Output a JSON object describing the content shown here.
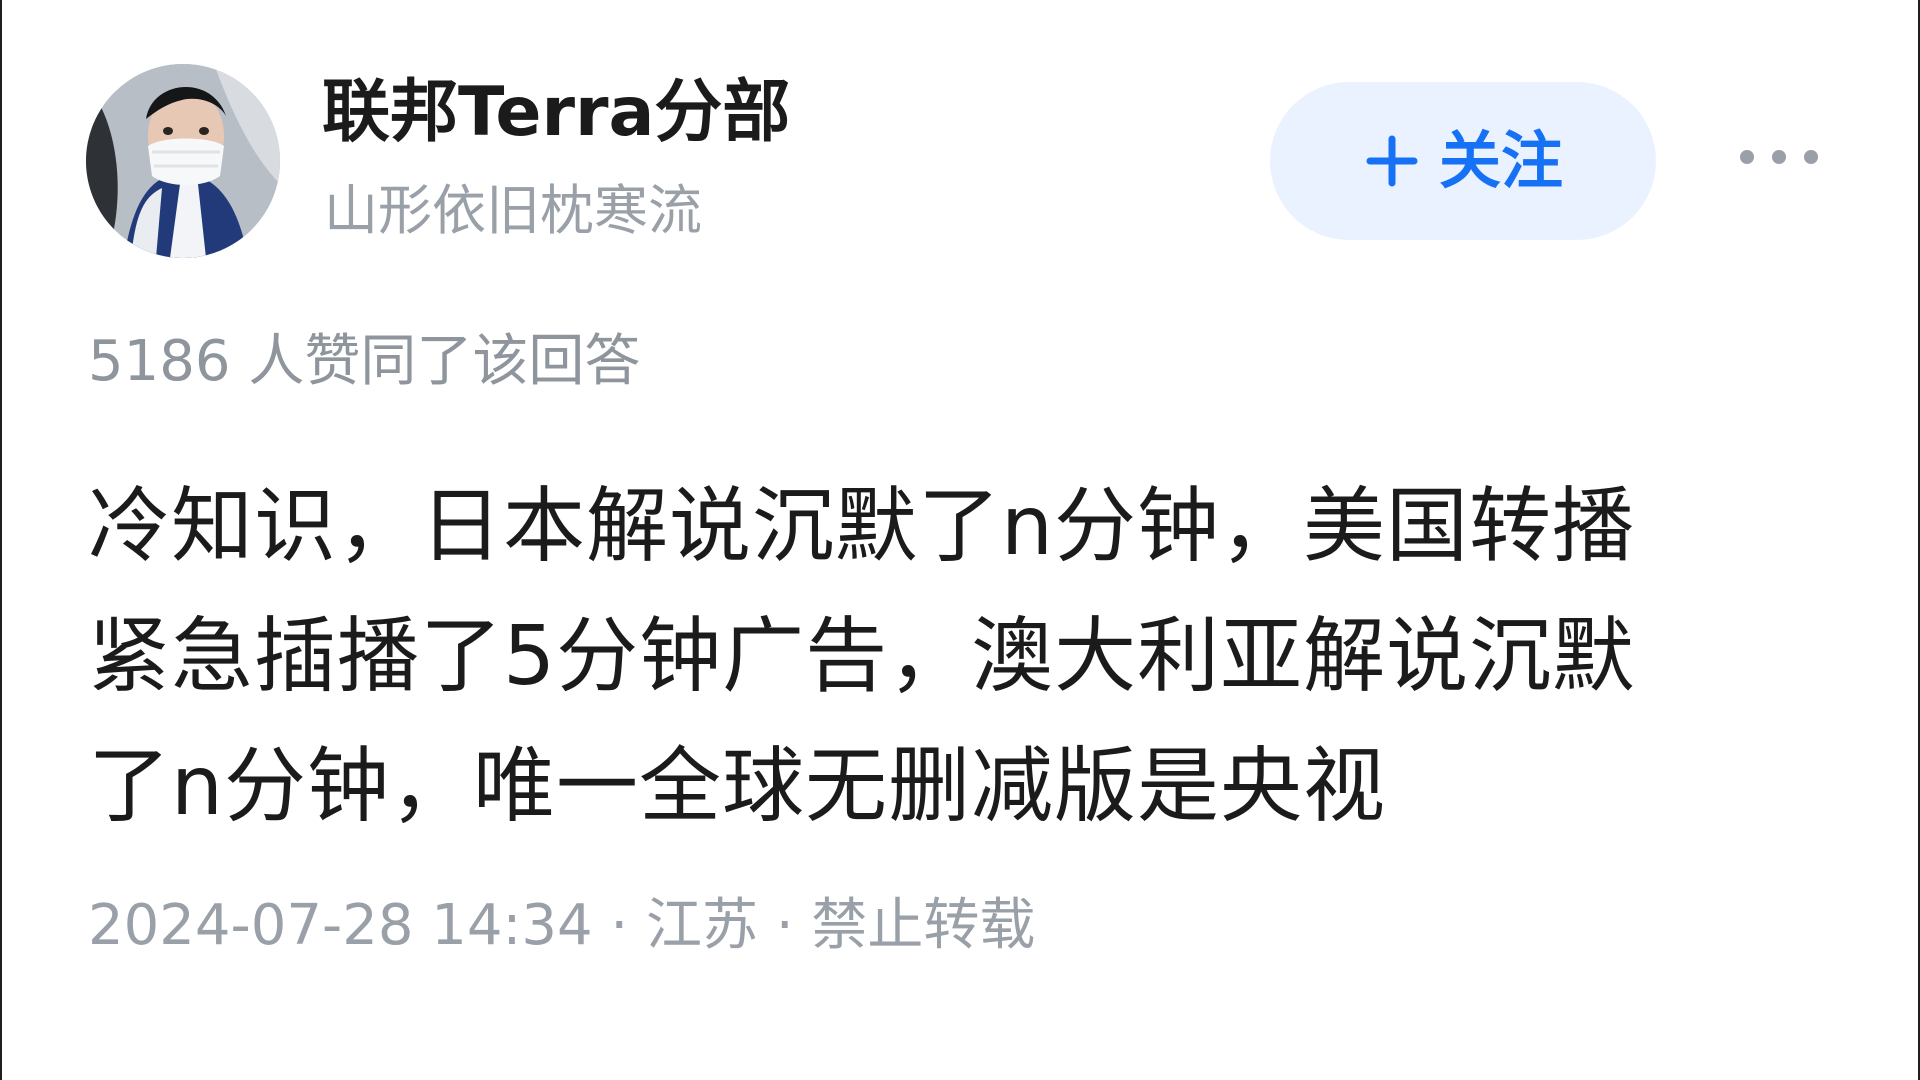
{
  "author": {
    "name": "联邦Terra分部",
    "bio": "山形依旧枕寒流"
  },
  "actions": {
    "follow_label": "关注",
    "follow_icon": "plus-icon",
    "more_icon": "more-horizontal-icon"
  },
  "answer": {
    "upvote_text": "5186 人赞同了该回答",
    "content_lines": [
      "冷知识，日本解说沉默了n分钟，美国转播",
      "紧急插播了5分钟广告，澳大利亚解说沉默",
      "了n分钟，唯一全球无删减版是央视"
    ],
    "meta_text": "2024-07-28 14:34 · 江苏 · 禁止转载"
  },
  "colors": {
    "accent": "#1771f4",
    "follow_bg": "#eaf2ff",
    "muted_text": "#9aa0a8",
    "main_text": "#1b1b1b"
  }
}
